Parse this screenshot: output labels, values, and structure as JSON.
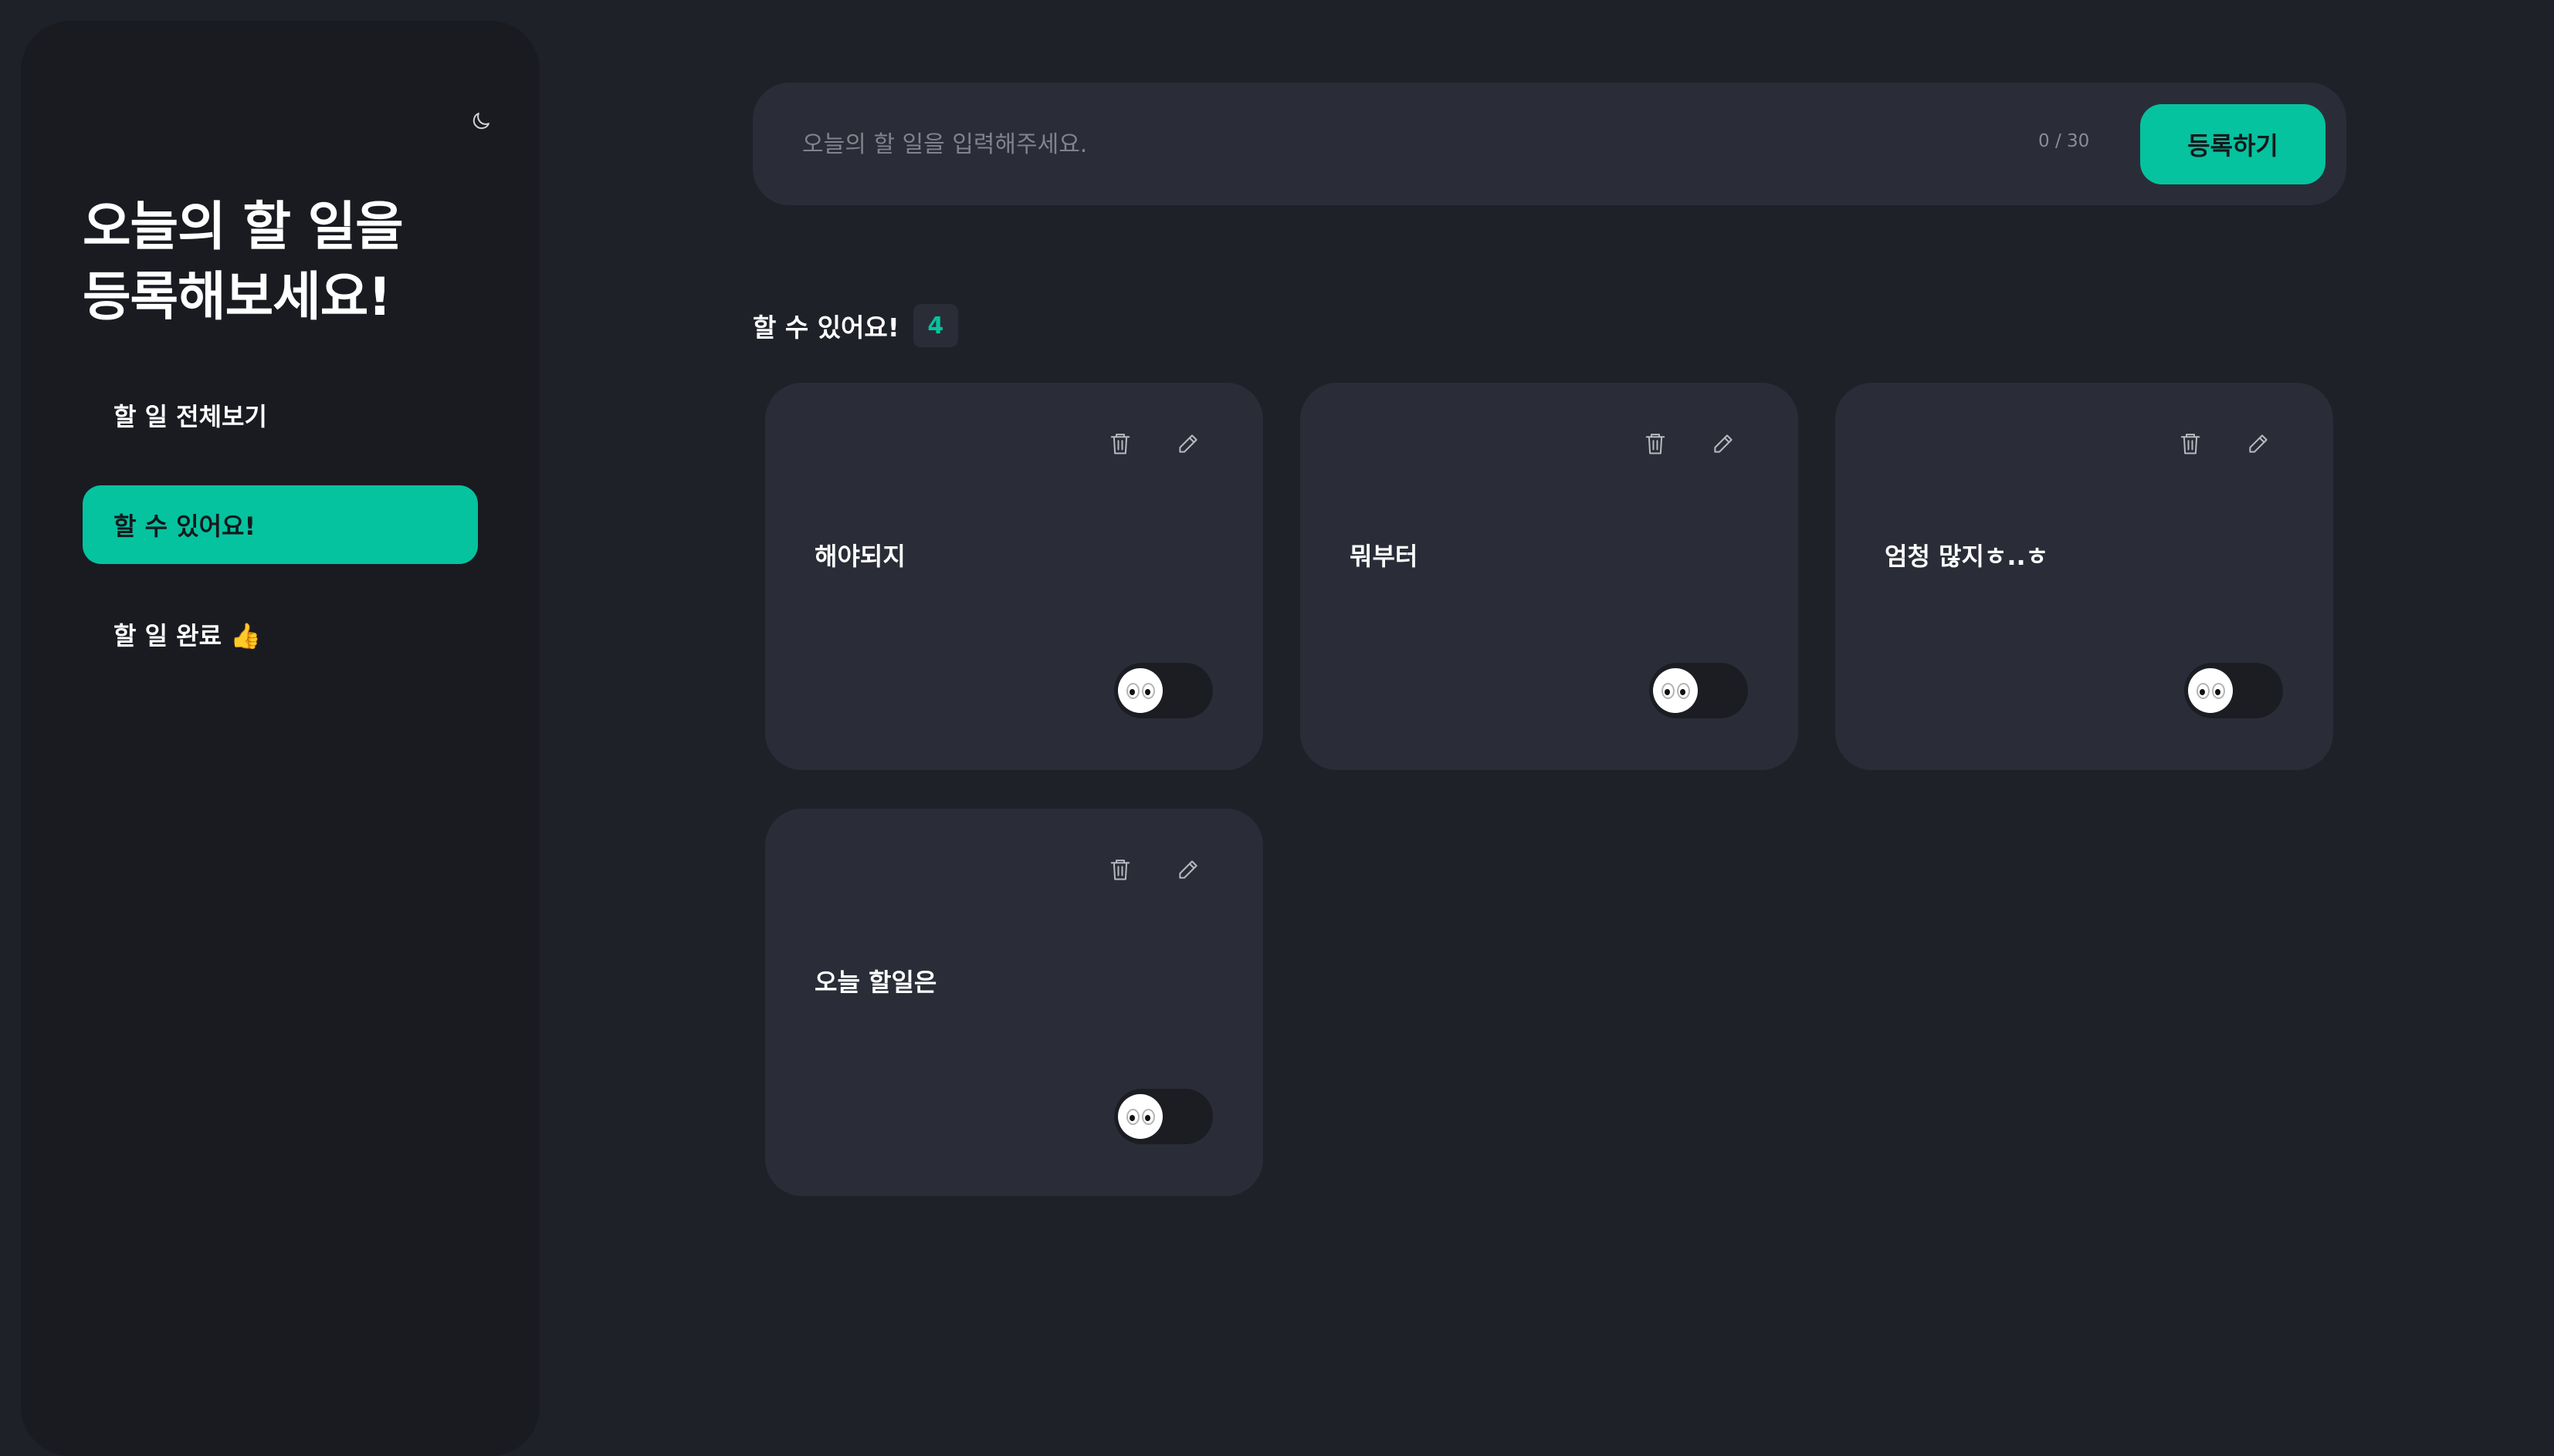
{
  "sidebar": {
    "title_line1": "오늘의 할 일을",
    "title_line2": "등록해보세요!",
    "theme_icon": "moon-icon",
    "nav": [
      {
        "label": "할 일 전체보기",
        "active": false
      },
      {
        "label": "할 수 있어요!",
        "active": true
      },
      {
        "label": "할 일 완료 👍",
        "active": false
      }
    ]
  },
  "input": {
    "placeholder": "오늘의 할 일을 입력해주세요.",
    "value": "",
    "counter": "0 / 30",
    "submit_label": "등록하기"
  },
  "section": {
    "title": "할 수 있어요!",
    "count": "4"
  },
  "todos": [
    {
      "text": "해야되지",
      "done": false
    },
    {
      "text": "뭐부터",
      "done": false
    },
    {
      "text": "엄청 많지ㅎ..ㅎ",
      "done": false
    },
    {
      "text": "오늘 할일은",
      "done": false
    }
  ],
  "colors": {
    "accent": "#05c39f",
    "background": "#1f2129",
    "sidebar": "#191b21",
    "card": "#2a2d37"
  },
  "icons": {
    "delete": "trash-icon",
    "edit": "pencil-icon",
    "toggle_knob": "eyes-icon"
  }
}
